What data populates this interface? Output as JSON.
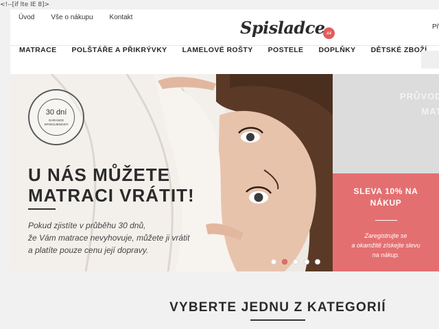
{
  "ie_comment": "<!--[if lte IE 8]>",
  "top_nav": [
    "Úvod",
    "Vše o nákupu",
    "Kontakt"
  ],
  "logo": {
    "text": "Spisladce",
    "badge": ".cz"
  },
  "top_right": "Př",
  "main_nav": [
    "MATRACE",
    "POLŠTÁŘE A PŘIKRÝVKY",
    "LAMELOVÉ ROŠTY",
    "POSTELE",
    "DOPLŇKY",
    "DĚTSKÉ ZBOŽÍ"
  ],
  "stamp": {
    "days": "30 dní",
    "guarantee": "GARANCE SPOKOJENOSTI"
  },
  "banner": {
    "headline_1": "U NÁS MŮŽETE",
    "headline_2": "MATRACI VRÁTIT!",
    "subtext_1": "Pokud zjistíte v průběhu 30 dnů,",
    "subtext_2": "že Vám matrace nevyhovuje, můžete ji vrátit",
    "subtext_3": "a platíte pouze cenu její dopravy."
  },
  "slider": {
    "count": 5,
    "active": 2
  },
  "side_top": {
    "line_1": "PRŮVODC",
    "line_2": "MATR"
  },
  "promo": {
    "title_1": "SLEVA 10% NA",
    "title_2": "NÁKUP",
    "text_1": "Zaregistrujte se",
    "text_2": "a okamžitě získejte slevu",
    "text_3": "na nákup."
  },
  "section_title": "VYBERTE JEDNU Z KATEGORIÍ",
  "colors": {
    "accent": "#e46f71",
    "text": "#2b2b2b"
  }
}
